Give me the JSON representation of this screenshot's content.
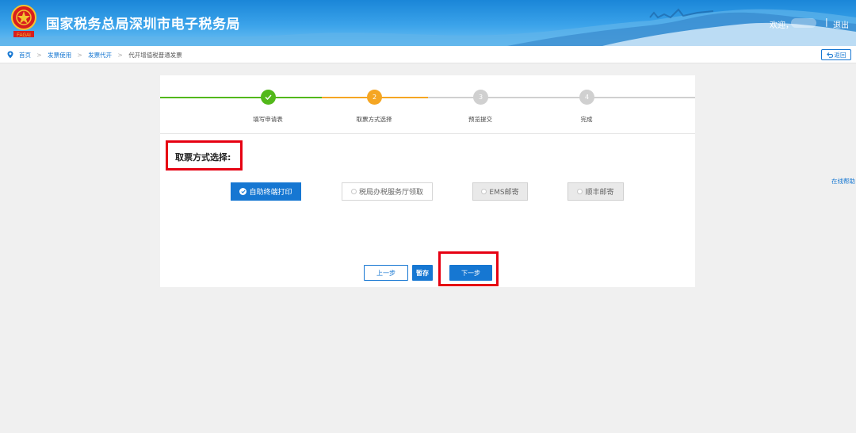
{
  "header": {
    "title": "国家税务总局深圳市电子税务局",
    "emblem_text": "FAGAI",
    "welcome": "欢迎，",
    "divider": "|",
    "logout": "退出"
  },
  "breadcrumb": {
    "items": [
      "首页",
      "发票使用",
      "发票代开",
      "代开增值税普通发票"
    ],
    "separator": ">",
    "back_label": "返回"
  },
  "help": {
    "label": "在线帮助"
  },
  "steps": [
    {
      "label": "填写申请表",
      "number": "1",
      "status": "done"
    },
    {
      "label": "取票方式选择",
      "number": "2",
      "status": "current"
    },
    {
      "label": "预览提交",
      "number": "3",
      "status": "pending"
    },
    {
      "label": "完成",
      "number": "4",
      "status": "pending"
    }
  ],
  "section": {
    "title": "取票方式选择:"
  },
  "options": [
    {
      "label": "自助终端打印",
      "state": "selected"
    },
    {
      "label": "税局办税服务厅领取",
      "state": "normal"
    },
    {
      "label": "EMS邮寄",
      "state": "disabled"
    },
    {
      "label": "顺丰邮寄",
      "state": "disabled"
    }
  ],
  "buttons": {
    "prev": "上一步",
    "save": "暂存",
    "next": "下一步"
  },
  "colors": {
    "primary": "#1677d2",
    "done": "#52b81a",
    "current": "#f5a623",
    "pending": "#d0d0d0",
    "highlight": "#e60012"
  }
}
